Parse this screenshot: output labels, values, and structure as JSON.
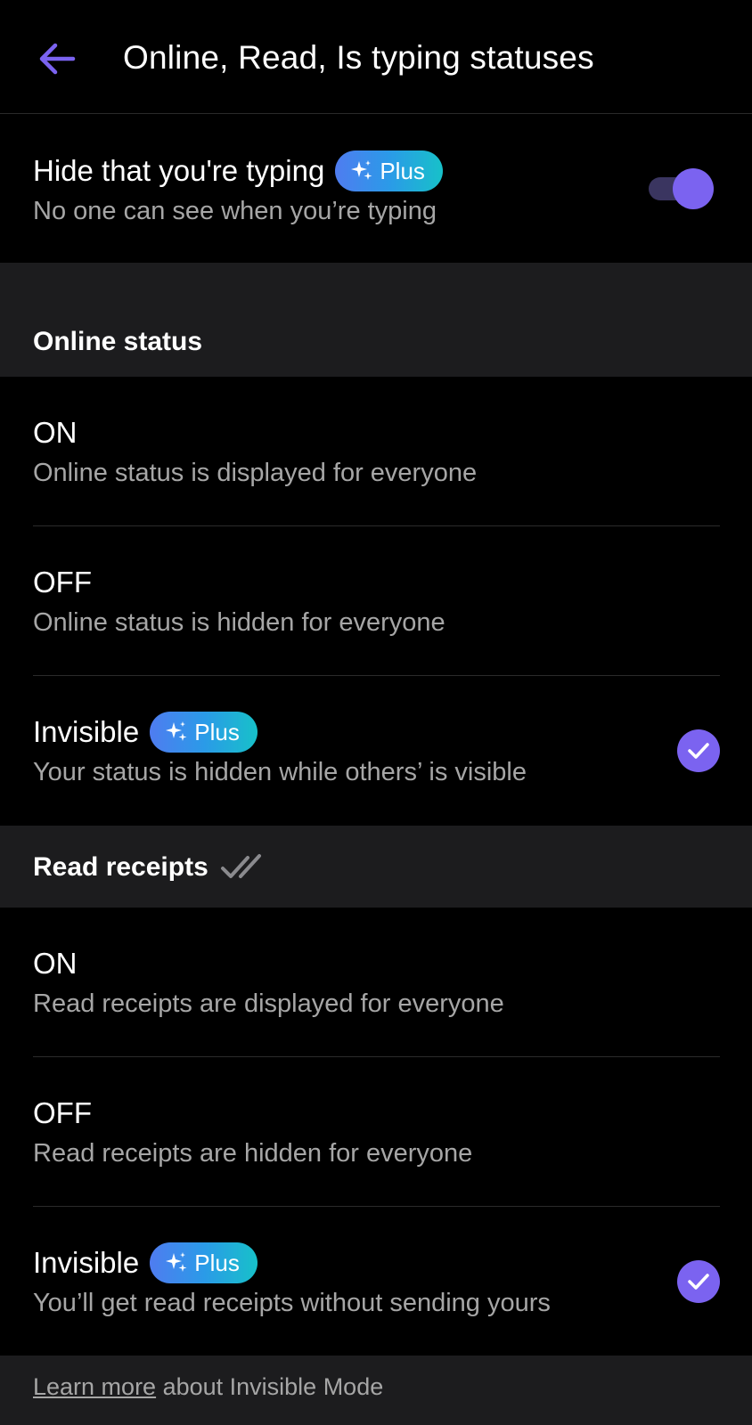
{
  "header": {
    "title": "Online, Read, Is typing statuses",
    "back_icon": "arrow-left-icon",
    "accent_color": "#7b63f0"
  },
  "badge": {
    "label": "Plus",
    "icon": "sparkle-icon"
  },
  "typing": {
    "title": "Hide that you're typing",
    "subtitle": "No one can see when you’re typing",
    "toggle_on": true
  },
  "online_status": {
    "section_title": "Online status",
    "options": [
      {
        "title": "ON",
        "subtitle": "Online status is displayed for everyone",
        "selected": false
      },
      {
        "title": "OFF",
        "subtitle": "Online status is hidden for everyone",
        "selected": false
      },
      {
        "title": "Invisible",
        "subtitle": "Your status is hidden while others’ is visible",
        "selected": true,
        "plus": true
      }
    ]
  },
  "read_receipts": {
    "section_title": "Read receipts",
    "section_icon": "double-check-icon",
    "options": [
      {
        "title": "ON",
        "subtitle": "Read receipts are displayed for everyone",
        "selected": false
      },
      {
        "title": "OFF",
        "subtitle": "Read receipts are hidden for everyone",
        "selected": false
      },
      {
        "title": "Invisible",
        "subtitle": "You’ll get read receipts without sending yours",
        "selected": true,
        "plus": true
      }
    ]
  },
  "footer": {
    "link_text": "Learn more",
    "text": " about Invisible Mode"
  }
}
